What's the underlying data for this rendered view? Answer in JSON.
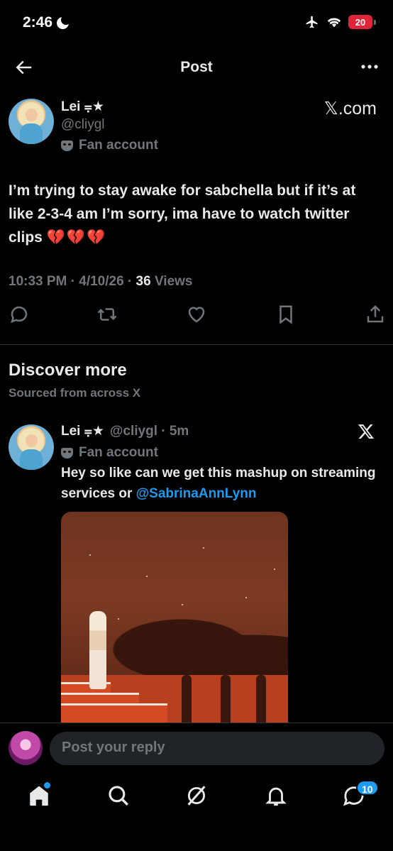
{
  "status_bar": {
    "time": "2:46",
    "battery": "20"
  },
  "header": {
    "title": "Post"
  },
  "post": {
    "author_name": "Lei ⩦★",
    "author_handle": "@cliygl",
    "label": "Fan account",
    "source": "𝕏.com",
    "text_main": "I’m trying to stay awake for sabchella but if it’s at like 2-3-4 am I’m sorry, ima have to watch twitter clips ",
    "text_emoji": "💔💔💔",
    "time": "10:33 PM · 4/10/26 · ",
    "views_count": "36",
    "views_label": " Views"
  },
  "discover": {
    "title": "Discover more",
    "subtitle": "Sourced from across X"
  },
  "tweet2": {
    "author_name": "Lei ⩦★",
    "author_handle": "@cliygl · 5m",
    "label": "Fan account",
    "text_main": "Hey so like can we get this mashup on streaming services or ",
    "mention": "@SabrinaAnnLynn"
  },
  "reply": {
    "placeholder": "Post your reply"
  },
  "nav": {
    "messages_badge": "10"
  },
  "colors": {
    "accent": "#1d9bf0",
    "background": "#000000",
    "muted": "#71767b"
  }
}
